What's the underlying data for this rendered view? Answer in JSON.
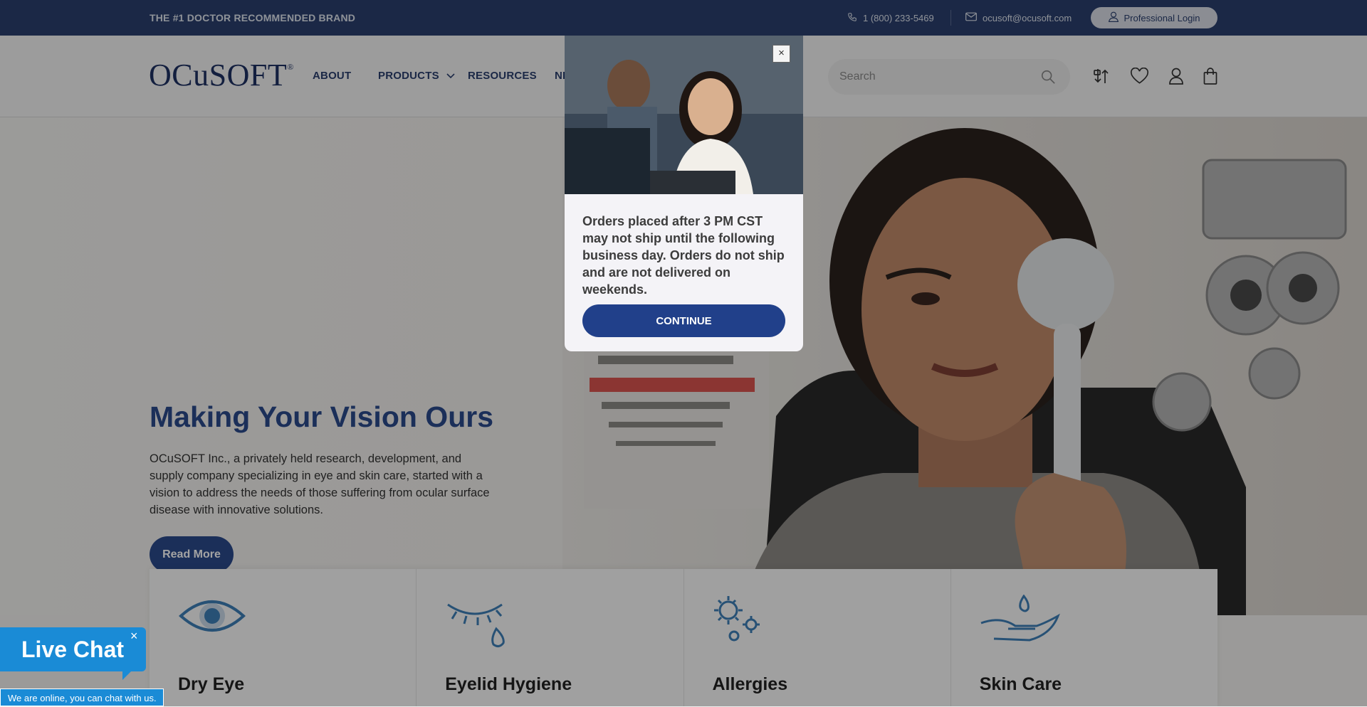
{
  "topbar": {
    "tagline": "THE #1 DOCTOR RECOMMENDED BRAND",
    "phone": "1 (800) 233-5469",
    "email": "ocusoft@ocusoft.com",
    "pro_login": "Professional Login"
  },
  "header": {
    "logo": "OCuSOFT",
    "logo_mark": "®",
    "nav": [
      "ABOUT",
      "PRODUCTS",
      "RESOURCES",
      "NE"
    ],
    "search_placeholder": "Search"
  },
  "hero": {
    "title": "Making Your Vision Ours",
    "text": "OCuSOFT Inc., a privately held research, development, and supply company specializing in eye and skin care, started with a vision to address the needs of those suffering from ocular surface disease with innovative solutions.",
    "button": "Read More"
  },
  "categories": [
    "Dry Eye",
    "Eyelid Hygiene",
    "Allergies",
    "Skin Care"
  ],
  "modal": {
    "close": "×",
    "message": "Orders placed after 3 PM CST may not ship until the following business day. Orders do not ship and are not delivered on weekends.",
    "button": "CONTINUE"
  },
  "livechat": {
    "title": "Live Chat",
    "close": "×",
    "status": "We are online, you can chat with us."
  },
  "colors": {
    "brand_navy": "#2b3f6e",
    "hero_title": "#2b4a8c",
    "continue_button": "#21408a",
    "livechat": "#1a8bd6"
  }
}
